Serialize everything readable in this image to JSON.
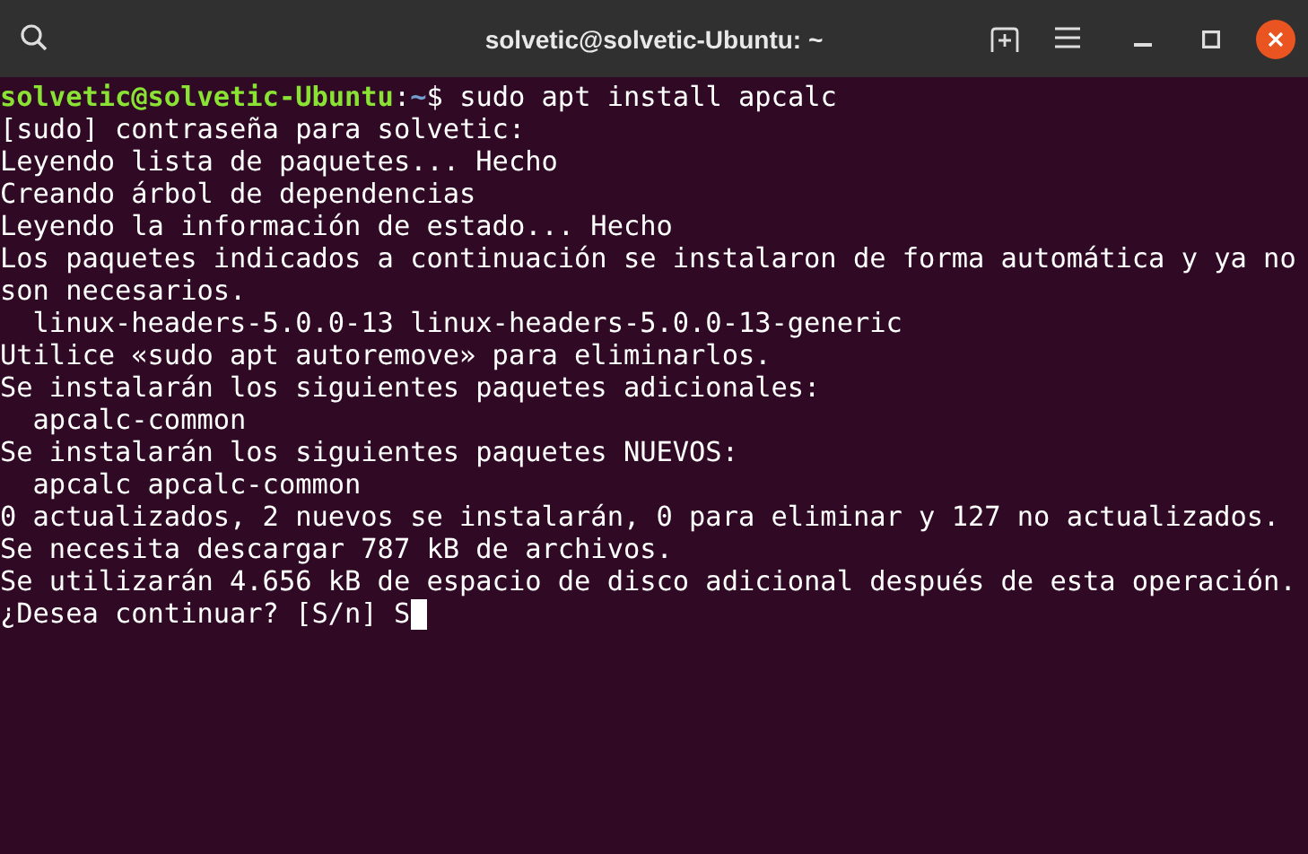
{
  "window": {
    "title": "solvetic@solvetic-Ubuntu: ~"
  },
  "terminal": {
    "prompt": {
      "user_host": "solvetic@solvetic-Ubuntu",
      "separator": ":",
      "path": "~",
      "symbol": "$",
      "command": " sudo apt install apcalc"
    },
    "lines": [
      "[sudo] contraseña para solvetic:",
      "Leyendo lista de paquetes... Hecho",
      "Creando árbol de dependencias",
      "Leyendo la información de estado... Hecho",
      "Los paquetes indicados a continuación se instalaron de forma automática y ya no",
      "son necesarios.",
      "  linux-headers-5.0.0-13 linux-headers-5.0.0-13-generic",
      "Utilice «sudo apt autoremove» para eliminarlos.",
      "Se instalarán los siguientes paquetes adicionales:",
      "  apcalc-common",
      "Se instalarán los siguientes paquetes NUEVOS:",
      "  apcalc apcalc-common",
      "0 actualizados, 2 nuevos se instalarán, 0 para eliminar y 127 no actualizados.",
      "Se necesita descargar 787 kB de archivos.",
      "Se utilizarán 4.656 kB de espacio de disco adicional después de esta operación.",
      "¿Desea continuar? [S/n] S"
    ]
  }
}
